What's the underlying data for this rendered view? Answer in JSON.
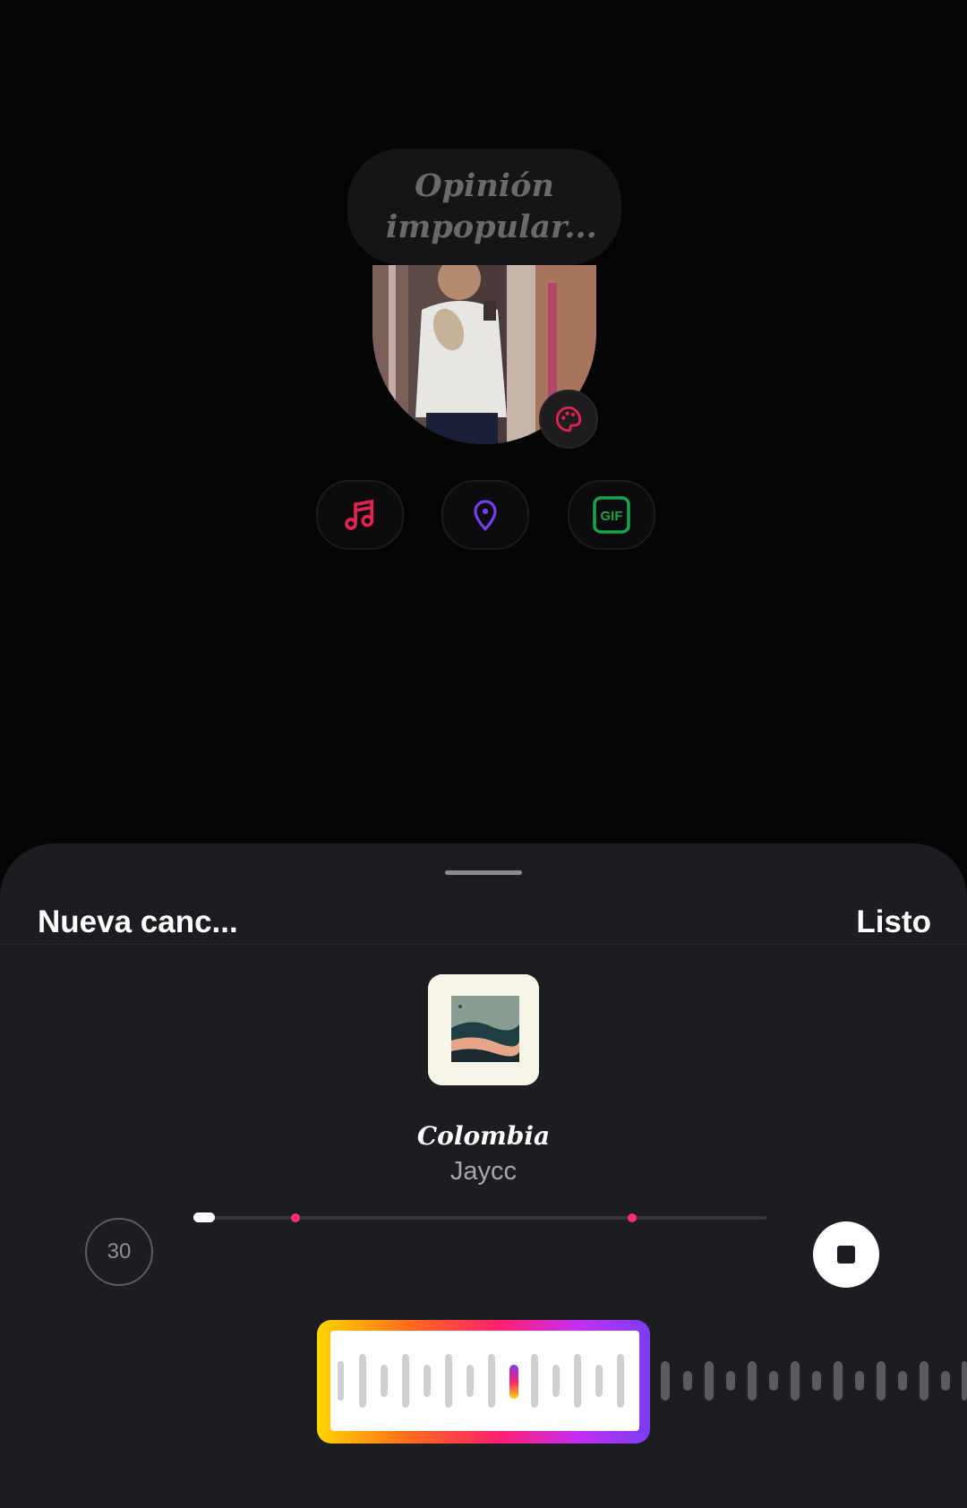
{
  "status_prompt": {
    "text": "Opinión impopular..."
  },
  "media_buttons": [
    {
      "name": "music",
      "icon": "music-note-icon",
      "color": "#e3234f"
    },
    {
      "name": "location",
      "icon": "location-pin-icon",
      "color": "#7a3cf0"
    },
    {
      "name": "gif",
      "icon": "gif-icon",
      "label": "GIF",
      "color": "#19a34a"
    }
  ],
  "profile": {
    "avatar_icon": "profile-photo",
    "edit_icon": "palette-icon"
  },
  "music_sheet": {
    "title": "Nueva canc...",
    "done_label": "Listo",
    "song": {
      "title": "Colombia",
      "artist": "Jaycc"
    },
    "clip_duration": "30",
    "playback_state": "playing",
    "stop_icon": "stop-icon",
    "accent_colors": [
      "#ffd500",
      "#ff1f6f",
      "#7b3cf3"
    ]
  }
}
